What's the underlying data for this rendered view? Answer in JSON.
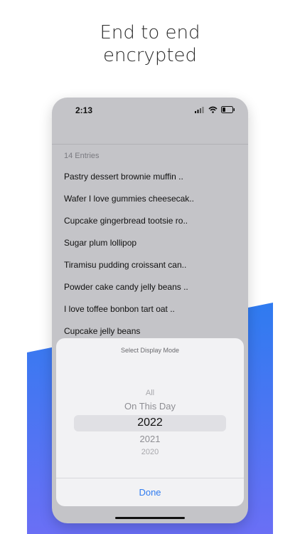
{
  "headline": {
    "line1": "End to end",
    "line2": "encrypted"
  },
  "status_bar": {
    "time": "2:13"
  },
  "list": {
    "entries_count": "14 Entries",
    "entries": [
      "Pastry dessert brownie muffin ..",
      "Wafer I love gummies cheesecak..",
      "Cupcake gingerbread tootsie ro..",
      "Sugar plum lollipop",
      "Tiramisu pudding croissant can..",
      "Powder cake candy jelly beans ..",
      "I love toffee bonbon tart oat ..",
      "Cupcake jelly beans"
    ]
  },
  "sheet": {
    "title": "Select Display Mode",
    "options": [
      "All",
      "On This Day",
      "2022",
      "2021",
      "2020"
    ],
    "selected": "2022",
    "done_label": "Done"
  },
  "colors": {
    "accent": "#2f7bf0",
    "band_top": "#2f7bf0",
    "band_bottom": "#6a6ff5"
  },
  "icons": [
    "signal-icon",
    "wifi-icon",
    "battery-icon"
  ]
}
